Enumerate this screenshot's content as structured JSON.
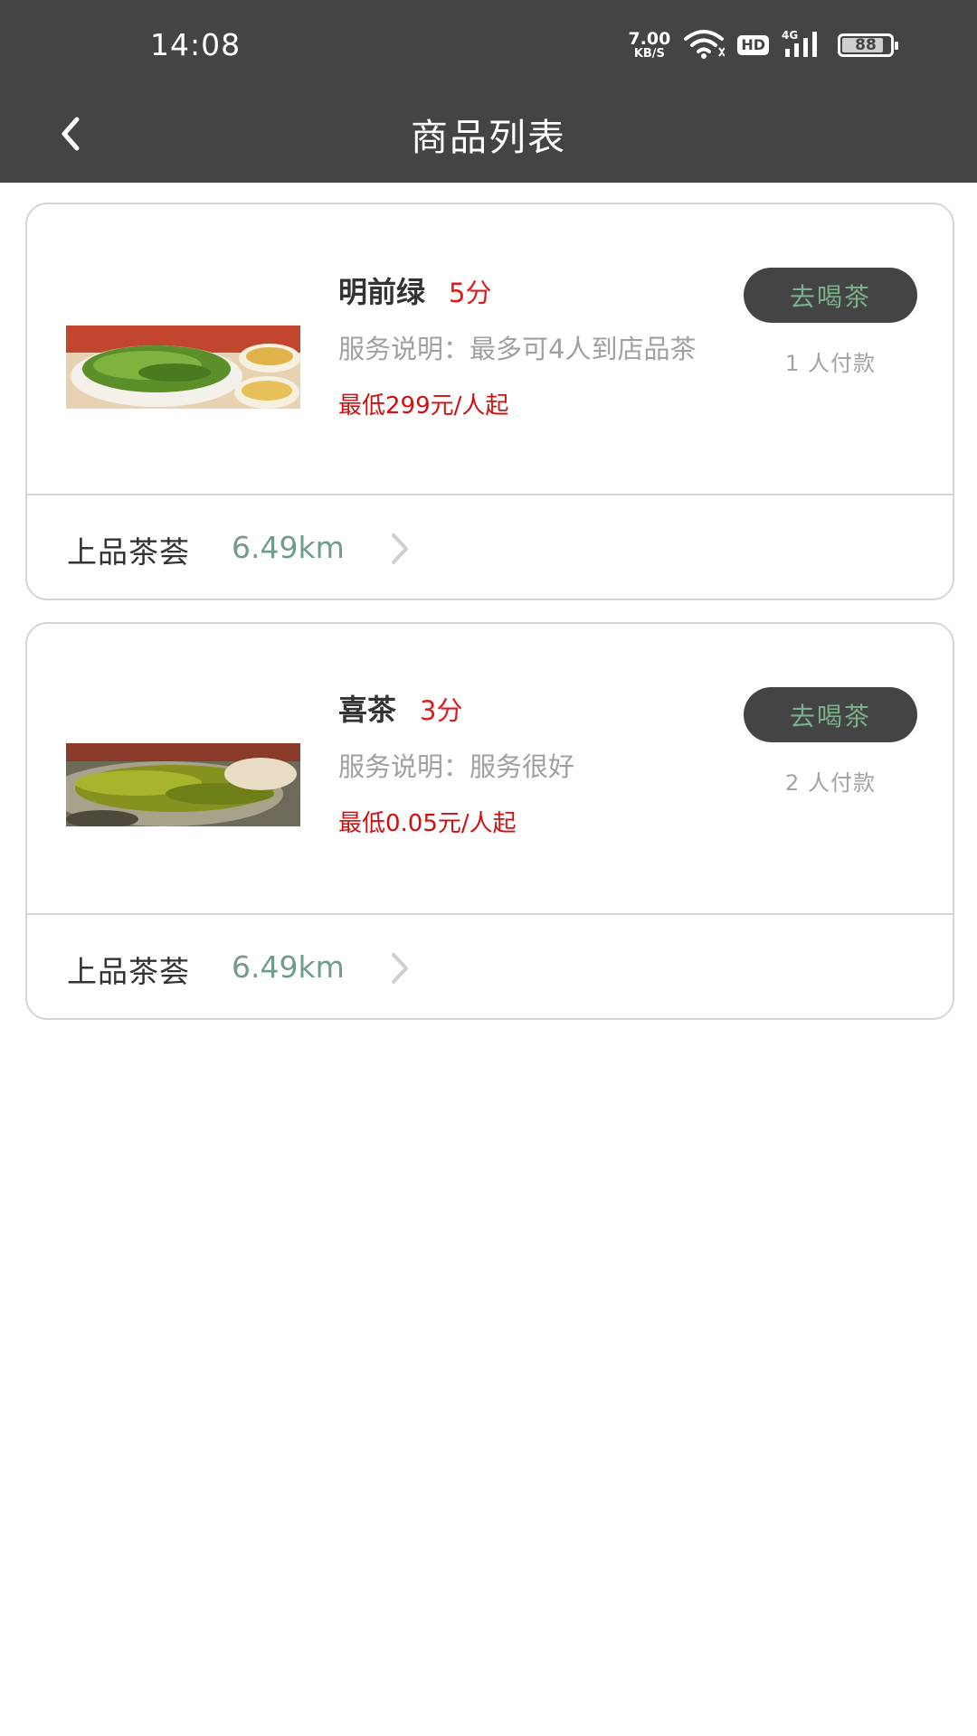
{
  "status_bar": {
    "time": "14:08",
    "speed_value": "7.00",
    "speed_unit": "KB/S",
    "hd": "HD",
    "network": "4G",
    "battery": "88",
    "icons": [
      "wifi-icon",
      "signal-icon",
      "battery-icon"
    ]
  },
  "nav": {
    "title": "商品列表",
    "back_icon": "chevron-left-icon"
  },
  "products": [
    {
      "title": "明前绿",
      "score": "5分",
      "desc": "服务说明：最多可4人到店品茶",
      "price": "最低299元/人起",
      "button": "去喝茶",
      "paid": "1 人付款",
      "shop": "上品茶荟",
      "distance": "6.49km"
    },
    {
      "title": "喜茶",
      "score": "3分",
      "desc": "服务说明：服务很好",
      "price": "最低0.05元/人起",
      "button": "去喝茶",
      "paid": "2 人付款",
      "shop": "上品茶荟",
      "distance": "6.49km"
    }
  ],
  "colors": {
    "header_bg": "#444444",
    "price_red": "#d10f0f",
    "button_text": "#7bb08c",
    "distance": "#6f9d8a"
  }
}
